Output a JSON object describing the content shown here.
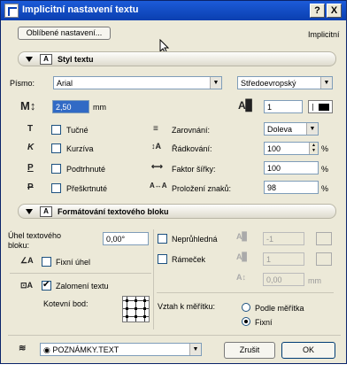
{
  "window": {
    "title": "Implicitní nastavení textu",
    "help": "?",
    "close": "X"
  },
  "top": {
    "favorites_button": "Oblíbené nastavení...",
    "default_label": "Implicitní"
  },
  "text_style": {
    "section_title": "Styl textu",
    "font_label": "Písmo:",
    "font_value": "Arial",
    "charset_value": "Středoevropský",
    "size_value": "2,50",
    "size_unit": "mm",
    "pen_value": "1",
    "bold_label": "Tučné",
    "italic_label": "Kurzíva",
    "underline_label": "Podtrhnuté",
    "strike_label": "Přeškrtnuté",
    "align_label": "Zarovnání:",
    "align_value": "Doleva",
    "leading_label": "Řádkování:",
    "leading_value": "100",
    "width_label": "Faktor šířky:",
    "width_value": "100",
    "spacing_label": "Proložení znaků:",
    "spacing_value": "98",
    "percent": "%"
  },
  "block": {
    "section_title": "Formátování textového bloku",
    "angle_label_1": "Úhel textového",
    "angle_label_2": "bloku:",
    "angle_value": "0,00°",
    "fixed_angle_label": "Fixní úhel",
    "wrap_label": "Zalomení textu",
    "anchor_label": "Kotevní bod:",
    "opaque_label": "Neprůhledná",
    "frame_label": "Rámeček",
    "pen_a_value": "-1",
    "pen_b_value": "1",
    "offset_value": "0,00",
    "offset_unit": "mm",
    "scale_label": "Vztah k měřítku:",
    "scale_option_1": "Podle měřítka",
    "scale_option_2": "Fixní"
  },
  "bottom": {
    "layer_value": "POZNÁMKY.TEXT",
    "cancel": "Zrušit",
    "ok": "OK"
  }
}
